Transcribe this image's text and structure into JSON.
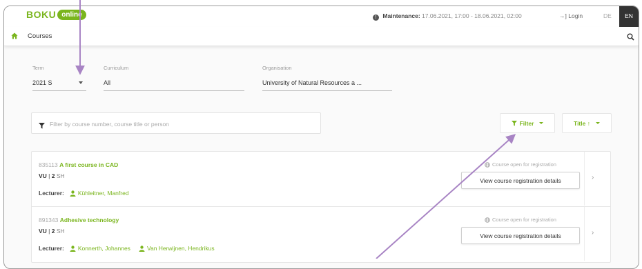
{
  "header": {
    "logo_text": "BOKU",
    "logo_badge": "online",
    "maintenance_label": "Maintenance:",
    "maintenance_text": "17.06.2021, 17:00 - 18.06.2021, 02:00",
    "login_label": "Login",
    "lang_de": "DE",
    "lang_en": "EN"
  },
  "nav": {
    "title": "Courses"
  },
  "filters": {
    "term_label": "Term",
    "term_value": "2021 S",
    "curriculum_label": "Curriculum",
    "curriculum_value": "All",
    "organisation_label": "Organisation",
    "organisation_value": "University of Natural Resources a ...",
    "search_placeholder": "Filter by course number, course title or person",
    "filter_button": "Filter",
    "sort_button": "Title ↑"
  },
  "courses": [
    {
      "number": "835113",
      "title": "A first course in CAD",
      "type": "VU",
      "hours": "2",
      "hours_unit": "SH",
      "lecturer_label": "Lecturer:",
      "lecturers": [
        "Kühleitner, Manfred"
      ],
      "status": "Course open for registration",
      "details_button": "View course registration details"
    },
    {
      "number": "891343",
      "title": "Adhesive technology",
      "type": "VU",
      "hours": "2",
      "hours_unit": "SH",
      "lecturer_label": "Lecturer:",
      "lecturers": [
        "Konnerth, Johannes",
        "Van Herwijnen, Hendrikus"
      ],
      "status": "Course open for registration",
      "details_button": "View course registration details"
    }
  ],
  "colors": {
    "brand_green": "#7ab51d",
    "annotation_arrow": "#a884c4",
    "lang_active_bg": "#333333"
  },
  "icons": [
    "home-icon",
    "search-icon",
    "info-icon",
    "login-icon",
    "funnel-icon",
    "user-icon",
    "globe-icon",
    "chevron-right-icon"
  ]
}
